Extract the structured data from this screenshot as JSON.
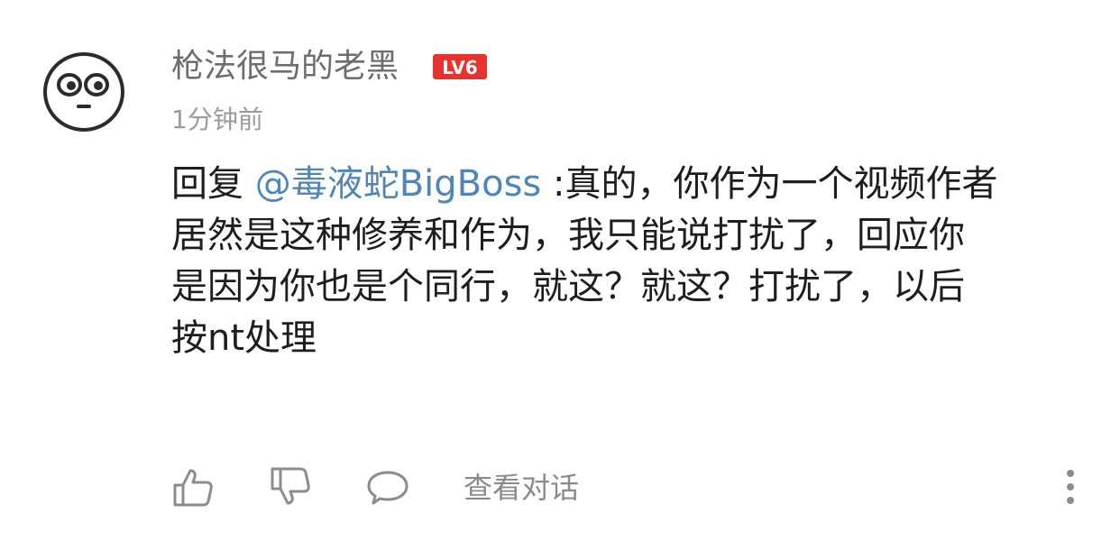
{
  "comment": {
    "username": "枪法很马的老黑",
    "level": "LV6",
    "timestamp": "1分钟前",
    "reply_prefix": "回复 ",
    "mention": "@毒液蛇BigBoss",
    "line1_rest": " :真的，你作为一个视频作者",
    "line2": "居然是这种修养和作为，我只能说打扰了，回应你",
    "line3": "是因为你也是个同行，就这？就这？打扰了，以后",
    "line4": "按nt处理"
  },
  "actions": {
    "like_icon": "thumb-up-icon",
    "dislike_icon": "thumb-down-icon",
    "reply_icon": "speech-bubble-icon",
    "view_conversation": "查看对话",
    "more_icon": "more-vertical-icon"
  },
  "colors": {
    "username": "#6d6d6d",
    "timestamp": "#9a9a9a",
    "text": "#1e1e1e",
    "mention": "#4f86b8",
    "level_badge": "#e8322d",
    "icon": "#8c8c8c"
  }
}
